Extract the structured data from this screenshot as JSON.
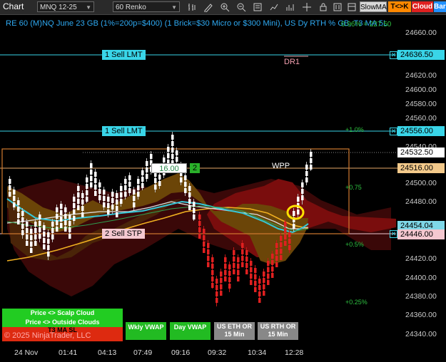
{
  "toolbar": {
    "title": "Chart",
    "instrument": "MNQ 12-25",
    "bar_type": "60 Renko",
    "slowma": "SlowMA",
    "tck": "T<>K",
    "cloud": "Cloud",
    "bars": "Bars",
    "colors": {
      "tck": "#ff8800",
      "cloud": "#e02020",
      "bars": "#2090ff"
    }
  },
  "chart": {
    "header_text": "RE 60 (M)NQ June 23 GB (1%=200p=$400) (1 Brick=$30 Micro or $300 Mini), US Dy RTH % GB, T3 MA 5L",
    "header_overlay": "0.96% = 227.50",
    "price_labels": [
      "24660.00",
      "24620.00",
      "24600.00",
      "24580.00",
      "24560.00",
      "24540.00",
      "24500.00",
      "24480.00",
      "24420.00",
      "24400.00",
      "24380.00",
      "24360.00",
      "24340.00"
    ],
    "price_tags": [
      {
        "text": "24636.50",
        "bg": "#39d5e8"
      },
      {
        "text": "24556.00",
        "bg": "#39d5e8"
      },
      {
        "text": "24532.50",
        "bg": "#ffffff"
      },
      {
        "text": "24516.00",
        "bg": "#f3c98a"
      },
      {
        "text": "24454.04",
        "bg": "#7fd8e8"
      },
      {
        "text": "24446.00",
        "bg": "#f4c8d0"
      }
    ],
    "time_labels": [
      "24 Nov",
      "01:41",
      "04:13",
      "07:49",
      "09:16",
      "09:32",
      "10:34",
      "12:28"
    ],
    "orders": {
      "sell_lmt_1": "1 Sell LMT",
      "sell_lmt_2": "1 Sell LMT",
      "sell_stp": "2 Sell STP",
      "qty_price": "16.00",
      "qty_count": "2"
    },
    "annotations": {
      "dr1": "DR1",
      "wpp": "WPP",
      "pct_1": "+1.0%",
      "pct_075": "+0.75",
      "pct_05": "+0.5%",
      "pct_025": "+0.25%"
    },
    "legend": {
      "scalp": "Price <> Scalp Cloud",
      "outside": "Price <> Outside Clouds",
      "t3": "T3 MA SL",
      "copyright": "© 2025 NinjaTrader, LLC"
    },
    "buttons": {
      "wkly_vwap": "Wkly VWAP",
      "day_vwap": "Day VWAP",
      "us_eth": "US ETH OR 15 Min",
      "us_rth": "US RTH OR 15 Min"
    }
  }
}
